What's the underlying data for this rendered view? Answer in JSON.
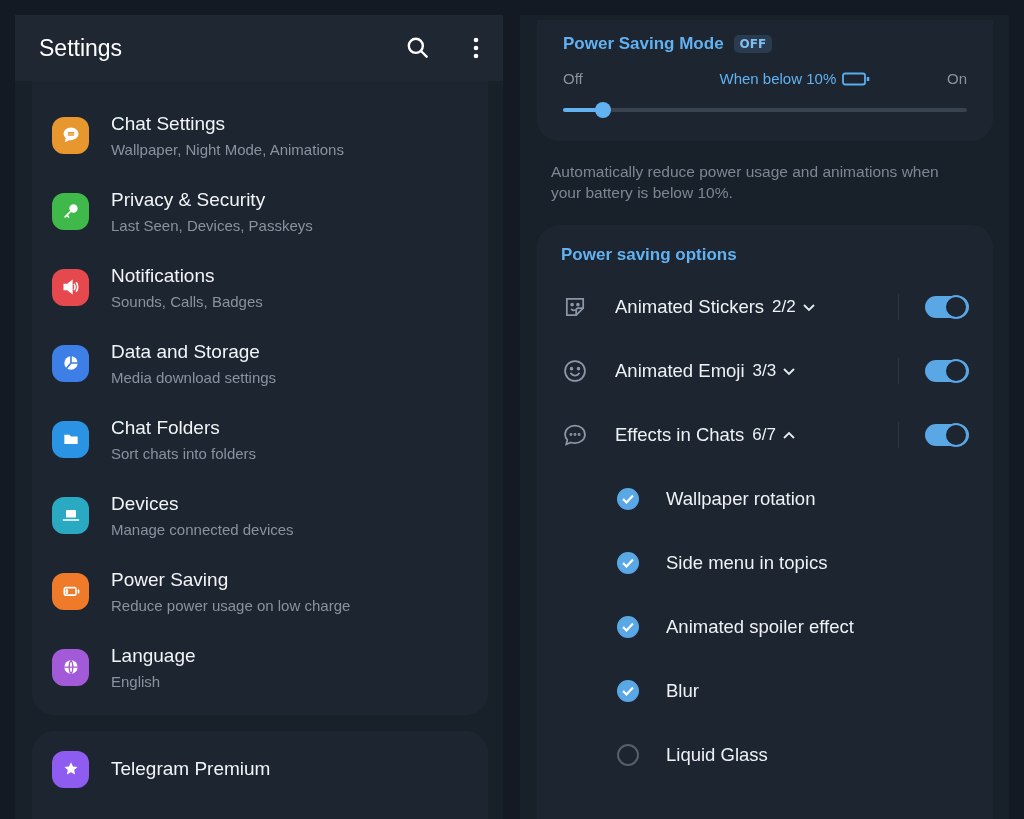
{
  "header": {
    "title": "Settings"
  },
  "menu": [
    {
      "title": "Chat Settings",
      "subtitle": "Wallpaper, Night Mode, Animations",
      "color": "#e8962e"
    },
    {
      "title": "Privacy & Security",
      "subtitle": "Last Seen, Devices, Passkeys",
      "color": "#3fb94a"
    },
    {
      "title": "Notifications",
      "subtitle": "Sounds, Calls, Badges",
      "color": "#e5484d"
    },
    {
      "title": "Data and Storage",
      "subtitle": "Media download settings",
      "color": "#3d7fe6"
    },
    {
      "title": "Chat Folders",
      "subtitle": "Sort chats into folders",
      "color": "#2b93e4"
    },
    {
      "title": "Devices",
      "subtitle": "Manage connected devices",
      "color": "#2aa9c2"
    },
    {
      "title": "Power Saving",
      "subtitle": "Reduce power usage on low charge",
      "color": "#ee7a2a"
    },
    {
      "title": "Language",
      "subtitle": "English",
      "color": "#a35ad8"
    }
  ],
  "premium": {
    "title": "Telegram Premium",
    "color": "#8e5cf0"
  },
  "power_mode": {
    "title": "Power Saving Mode",
    "badge": "OFF",
    "label_off": "Off",
    "label_mid": "When below 10%",
    "label_on": "On",
    "level": 0.1,
    "description": "Automatically reduce power usage and animations when your battery is below 10%."
  },
  "options": {
    "title": "Power saving options",
    "groups": [
      {
        "label": "Animated Stickers",
        "count": "2/2",
        "expanded": false,
        "on": true
      },
      {
        "label": "Animated Emoji",
        "count": "3/3",
        "expanded": false,
        "on": true
      },
      {
        "label": "Effects in Chats",
        "count": "6/7",
        "expanded": true,
        "on": true
      }
    ],
    "items": [
      {
        "label": "Wallpaper rotation",
        "checked": true
      },
      {
        "label": "Side menu in topics",
        "checked": true
      },
      {
        "label": "Animated spoiler effect",
        "checked": true
      },
      {
        "label": "Blur",
        "checked": true
      },
      {
        "label": "Liquid Glass",
        "checked": false
      }
    ]
  }
}
